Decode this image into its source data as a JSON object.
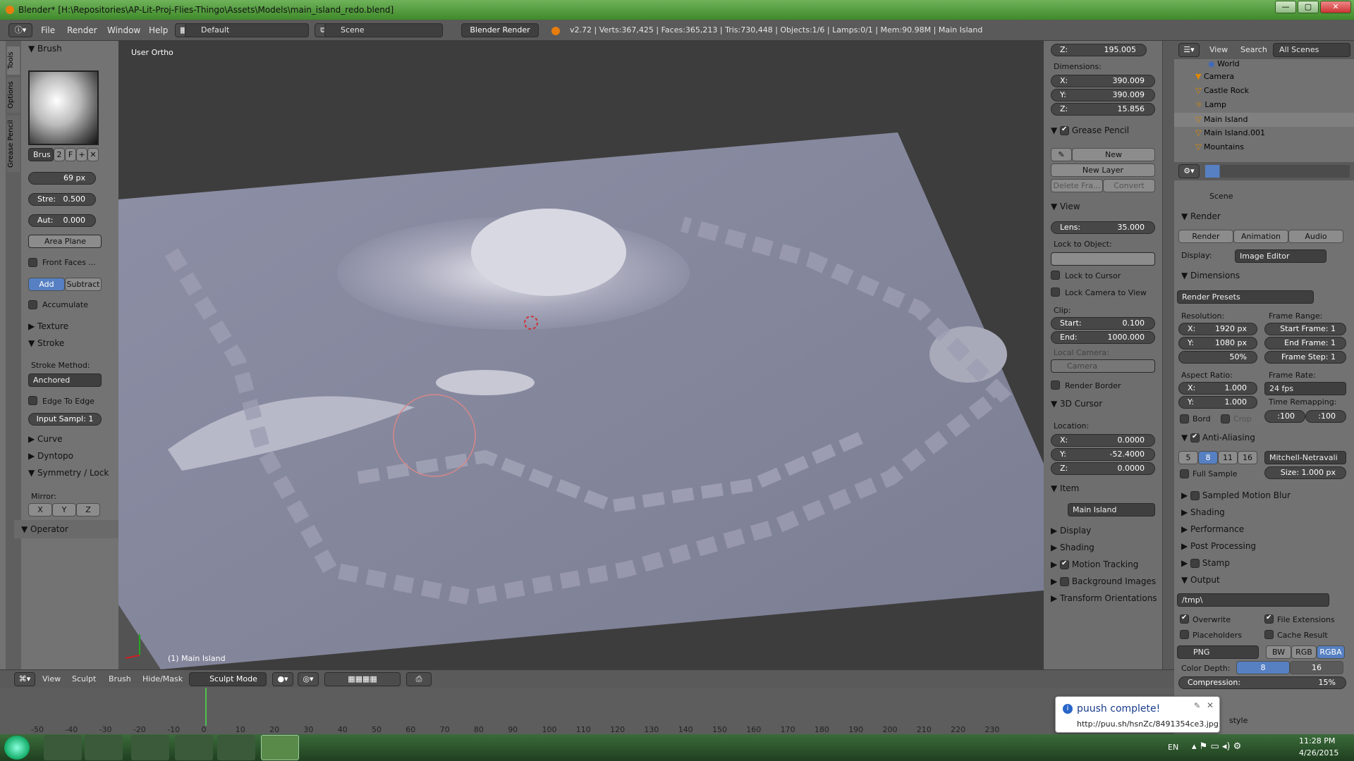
{
  "window": {
    "title": "Blender* [H:\\Repositories\\AP-Lit-Proj-Flies-Thingo\\Assets\\Models\\main_island_redo.blend]",
    "minimize_label": "—",
    "maximize_label": "▢",
    "close_label": "✕"
  },
  "info_header": {
    "menus": [
      "File",
      "Render",
      "Window",
      "Help"
    ],
    "layout": "Default",
    "scene": "Scene",
    "engine": "Blender Render",
    "stats": "v2.72 | Verts:367,425 | Faces:365,213 | Tris:730,448 | Objects:1/6 | Lamps:0/1 | Mem:90.98M | Main Island"
  },
  "side_tabs": [
    "Tools",
    "Options",
    "Grease Pencil"
  ],
  "tool_shelf": {
    "brush_title": "Brush",
    "brush_name": "Brus",
    "brush_users": "2",
    "brush_fake": "F",
    "radius": "69 px",
    "strength_label": "Stre:",
    "strength": "0.500",
    "autosmooth_label": "Aut:",
    "autosmooth": "0.000",
    "sculpt_plane": "Area Plane",
    "front_faces": "Front Faces ...",
    "add": "Add",
    "subtract": "Subtract",
    "accumulate": "Accumulate",
    "texture": "Texture",
    "stroke": "Stroke",
    "stroke_method_label": "Stroke Method:",
    "stroke_method": "Anchored",
    "edge_to_edge": "Edge To Edge",
    "input_samples": "Input Sampl: 1",
    "curve": "Curve",
    "dyntopo": "Dyntopo",
    "symmetry": "Symmetry / Lock",
    "mirror_label": "Mirror:",
    "mirror_axes": [
      "X",
      "Y",
      "Z"
    ],
    "operator": "Operator"
  },
  "viewport": {
    "view_label": "User Ortho",
    "object_label": "(1) Main Island"
  },
  "properties_n": {
    "loc_z_label": "Z:",
    "loc_z": "195.005",
    "dimensions_label": "Dimensions:",
    "dim": [
      {
        "k": "X:",
        "v": "390.009"
      },
      {
        "k": "Y:",
        "v": "390.009"
      },
      {
        "k": "Z:",
        "v": "15.856"
      }
    ],
    "grease_pencil": "Grease Pencil",
    "new": "New",
    "new_layer": "New Layer",
    "delete_frame": "Delete Fra...",
    "convert": "Convert",
    "view": "View",
    "lens_label": "Lens:",
    "lens": "35.000",
    "lock_to_object": "Lock to Object:",
    "lock_to_cursor": "Lock to Cursor",
    "lock_camera": "Lock Camera to View",
    "clip_label": "Clip:",
    "clip_start_label": "Start:",
    "clip_start": "0.100",
    "clip_end_label": "End:",
    "clip_end": "1000.000",
    "local_camera": "Local Camera:",
    "camera": "Camera",
    "render_border": "Render Border",
    "cursor_3d": "3D Cursor",
    "location_label": "Location:",
    "cursor_loc": [
      {
        "k": "X:",
        "v": "0.0000"
      },
      {
        "k": "Y:",
        "v": "-52.4000"
      },
      {
        "k": "Z:",
        "v": "0.0000"
      }
    ],
    "item": "Item",
    "item_name": "Main Island",
    "display": "Display",
    "shading": "Shading",
    "motion_tracking": "Motion Tracking",
    "background_images": "Background Images",
    "transform_orientations": "Transform Orientations"
  },
  "outliner": {
    "view": "View",
    "search": "Search",
    "all_scenes": "All Scenes",
    "items": [
      "World",
      "Camera",
      "Castle Rock",
      "Lamp",
      "Main Island",
      "Main Island.001",
      "Mountains"
    ]
  },
  "properties": {
    "scene": "Scene",
    "render": "Render",
    "render_btn": "Render",
    "animation_btn": "Animation",
    "audio_btn": "Audio",
    "display_label": "Display:",
    "display_value": "Image Editor",
    "dimensions": "Dimensions",
    "render_presets": "Render Presets",
    "resolution_label": "Resolution:",
    "res_x": "1920 px",
    "res_y": "1080 px",
    "res_pct": "50%",
    "frame_range_label": "Frame Range:",
    "start_frame": "Start Frame: 1",
    "end_frame": "End Frame: 1",
    "frame_step": "Frame Step: 1",
    "aspect_label": "Aspect Ratio:",
    "aspect_x": "1.000",
    "aspect_y": "1.000",
    "frame_rate_label": "Frame Rate:",
    "frame_rate": "24 fps",
    "bord": "Bord",
    "crop": "Crop",
    "time_remap_label": "Time Remapping:",
    "time_old": ":100",
    "time_new": ":100",
    "anti_aliasing": "Anti-Aliasing",
    "aa_samples": [
      "5",
      "8",
      "11",
      "16"
    ],
    "filter": "Mitchell-Netravali",
    "full_sample": "Full Sample",
    "size": "Size: 1.000 px",
    "sampled_motion_blur": "Sampled Motion Blur",
    "shading": "Shading",
    "performance": "Performance",
    "post_processing": "Post Processing",
    "stamp": "Stamp",
    "output": "Output",
    "output_path": "/tmp\\",
    "overwrite": "Overwrite",
    "file_extensions": "File Extensions",
    "placeholders": "Placeholders",
    "cache_result": "Cache Result",
    "format": "PNG",
    "bw": "BW",
    "rgb": "RGB",
    "rgba": "RGBA",
    "color_depth_label": "Color Depth:",
    "depth_8": "8",
    "depth_16": "16",
    "compression_label": "Compression:",
    "compression": "15%",
    "style_fragment": "style"
  },
  "vp_header": {
    "menus": [
      "View",
      "Sculpt",
      "Brush",
      "Hide/Mask"
    ],
    "mode": "Sculpt Mode"
  },
  "timeline": {
    "ticks": [
      "-50",
      "-40",
      "-30",
      "-20",
      "-10",
      "0",
      "10",
      "20",
      "30",
      "40",
      "50",
      "60",
      "70",
      "80",
      "90",
      "100",
      "110",
      "120",
      "130",
      "140",
      "150",
      "160",
      "170",
      "180",
      "190",
      "200",
      "210",
      "220",
      "230"
    ],
    "current_frame": 1
  },
  "notification": {
    "title": "puush complete!",
    "url": "http://puu.sh/hsnZc/8491354ce3.jpg"
  },
  "taskbar": {
    "lang": "EN",
    "time": "11:28 PM",
    "date": "4/26/2015"
  },
  "colors": {
    "accent_blue": "#5680c2",
    "title_green": "#4f9a3a",
    "viewport_bg": "#3d3d3d",
    "terrain": "#8a8aa0"
  }
}
